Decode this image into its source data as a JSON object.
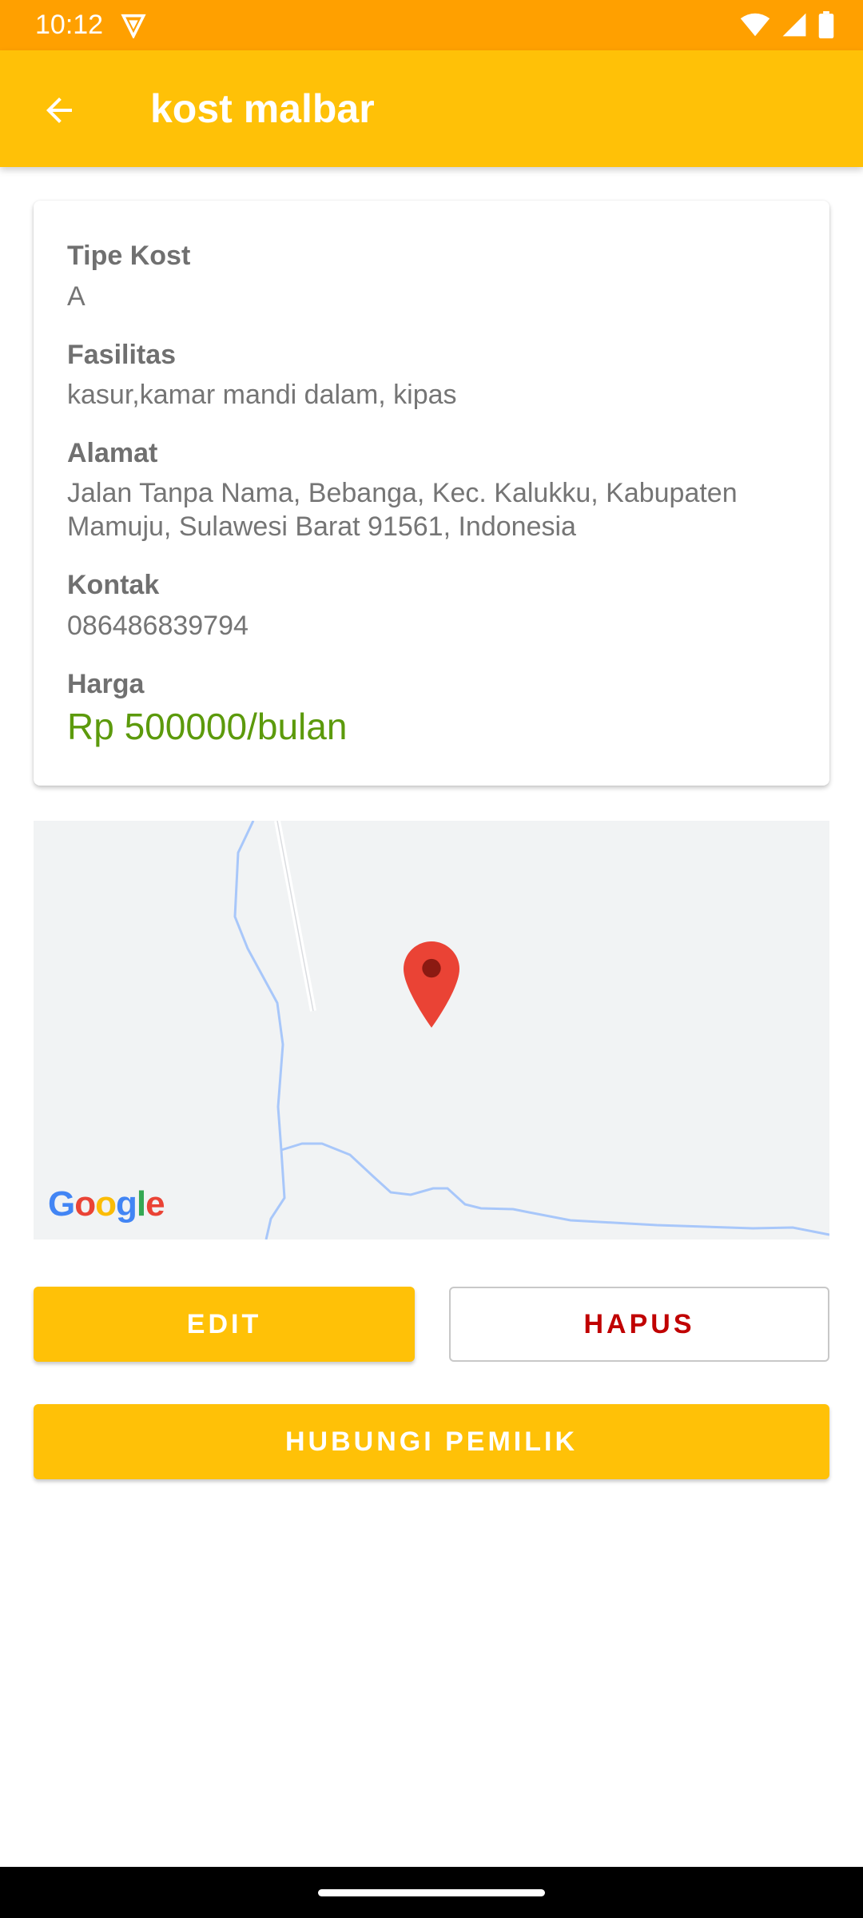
{
  "status_bar": {
    "time": "10:12",
    "icons": [
      "shield-icon",
      "wifi-icon",
      "cell-signal-icon",
      "battery-icon"
    ]
  },
  "app_bar": {
    "title": "kost malbar",
    "back_icon": "arrow-back-icon"
  },
  "details": {
    "tipe_label": "Tipe Kost",
    "tipe_value": "A",
    "fasilitas_label": "Fasilitas",
    "fasilitas_value": "kasur,kamar mandi dalam, kipas",
    "alamat_label": "Alamat",
    "alamat_value": "Jalan Tanpa Nama, Bebanga, Kec. Kalukku, Kabupaten Mamuju, Sulawesi Barat 91561, Indonesia",
    "kontak_label": "Kontak",
    "kontak_value": "086486839794",
    "harga_label": "Harga",
    "harga_value": "Rp 500000/bulan"
  },
  "map": {
    "attribution": "Google",
    "marker_icon": "map-pin-icon"
  },
  "actions": {
    "edit_label": "EDIT",
    "hapus_label": "HAPUS",
    "hubungi_label": "HUBUNGI PEMILIK"
  },
  "colors": {
    "status_bar": "#FFA000",
    "app_bar": "#FFC107",
    "price": "#5C9A0C",
    "delete": "#C00000"
  }
}
